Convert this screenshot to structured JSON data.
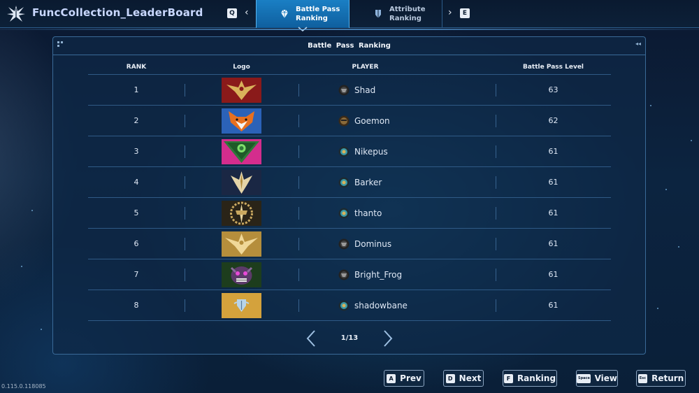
{
  "app": {
    "title": "FuncCollection_LeaderBoard",
    "version": "0.115.0.118085"
  },
  "tabbar": {
    "prev_key": "Q",
    "next_key": "E",
    "tabs": [
      {
        "label_line1": "Battle Pass",
        "label_line2": "Ranking",
        "icon": "diamond-icon",
        "active": true
      },
      {
        "label_line1": "Attribute",
        "label_line2": "Ranking",
        "icon": "shield-badge-icon",
        "active": false
      }
    ]
  },
  "panel": {
    "title": "Battle Pass  Ranking"
  },
  "table": {
    "headers": {
      "rank": "RANK",
      "logo": "Logo",
      "player": "PLAYER",
      "level": "Battle Pass Level"
    },
    "rows": [
      {
        "rank": "1",
        "logo": "gold-wings-emblem-red",
        "player_icon": "dark-avatar-icon",
        "player": "Shad",
        "level": "63"
      },
      {
        "rank": "2",
        "logo": "fox-emblem-blue",
        "player_icon": "bronze-avatar-icon",
        "player": "Goemon",
        "level": "62"
      },
      {
        "rank": "3",
        "logo": "green-orb-emblem-pink",
        "player_icon": "teal-avatar-icon",
        "player": "Nikepus",
        "level": "61"
      },
      {
        "rank": "4",
        "logo": "gold-crest-emblem-navy",
        "player_icon": "teal-avatar-icon",
        "player": "Barker",
        "level": "61"
      },
      {
        "rank": "5",
        "logo": "laurel-crown-emblem-dark",
        "player_icon": "teal-avatar-icon",
        "player": "thanto",
        "level": "61"
      },
      {
        "rank": "6",
        "logo": "gold-wings-emblem-gold",
        "player_icon": "dark-avatar-icon",
        "player": "Dominus",
        "level": "61"
      },
      {
        "rank": "7",
        "logo": "demon-face-emblem-green",
        "player_icon": "dark-avatar-icon",
        "player": "Bright_Frog",
        "level": "61"
      },
      {
        "rank": "8",
        "logo": "shield-emblem-gold",
        "player_icon": "teal-avatar-icon",
        "player": "shadowbane",
        "level": "61"
      }
    ]
  },
  "pagination": {
    "text": "1/13"
  },
  "bottom_bar": {
    "buttons": [
      {
        "key": "A",
        "label": "Prev"
      },
      {
        "key": "D",
        "label": "Next"
      },
      {
        "key": "F",
        "label": "Ranking"
      },
      {
        "key": "Space",
        "label": "View"
      },
      {
        "key": "Esc",
        "label": "Return"
      }
    ]
  },
  "colors": {
    "accent": "#1a7fc4",
    "panel_border": "#3a6a98",
    "background": "#0c2440"
  }
}
